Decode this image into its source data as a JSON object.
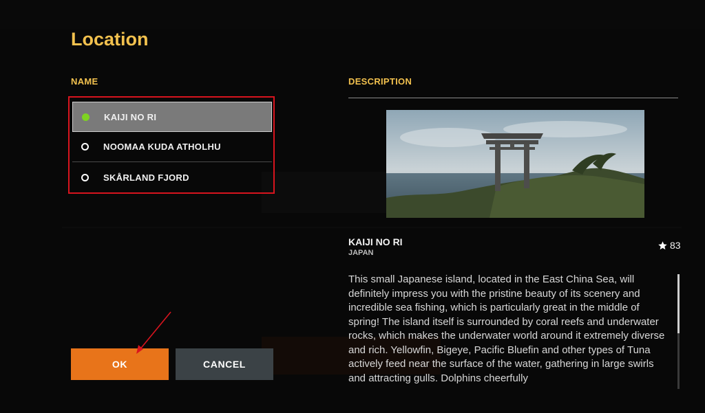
{
  "dialog": {
    "title": "Location",
    "name_header": "NAME",
    "description_header": "DESCRIPTION"
  },
  "locations": [
    {
      "label": "KAIJI NO RI",
      "selected": true
    },
    {
      "label": "NOOMAA KUDA ATHOLHU",
      "selected": false
    },
    {
      "label": "SKÅRLAND FJORD",
      "selected": false
    }
  ],
  "details": {
    "name": "KAIJI NO RI",
    "country": "JAPAN",
    "rating": "83",
    "description": "This small Japanese island, located in the East China Sea, will definitely impress you with the pristine beauty of its scenery and incredible sea fishing, which is particularly great in the middle of spring! The island itself is surrounded by coral reefs and underwater rocks, which makes the underwater world around it extremely diverse and rich. Yellowfin, Bigeye, Pacific Bluefin and other types of Tuna actively feed near the surface of the water, gathering in large swirls and attracting gulls. Dolphins cheerfully"
  },
  "buttons": {
    "ok": "OK",
    "cancel": "CANCEL"
  },
  "icons": {
    "active_dot": "green-dot-icon",
    "rating": "star-icon"
  },
  "colors": {
    "accent": "#f2c14e",
    "ok_button": "#e8741a",
    "cancel_button": "#3b4246",
    "highlight": "#d9141e",
    "active": "#7ed321"
  }
}
